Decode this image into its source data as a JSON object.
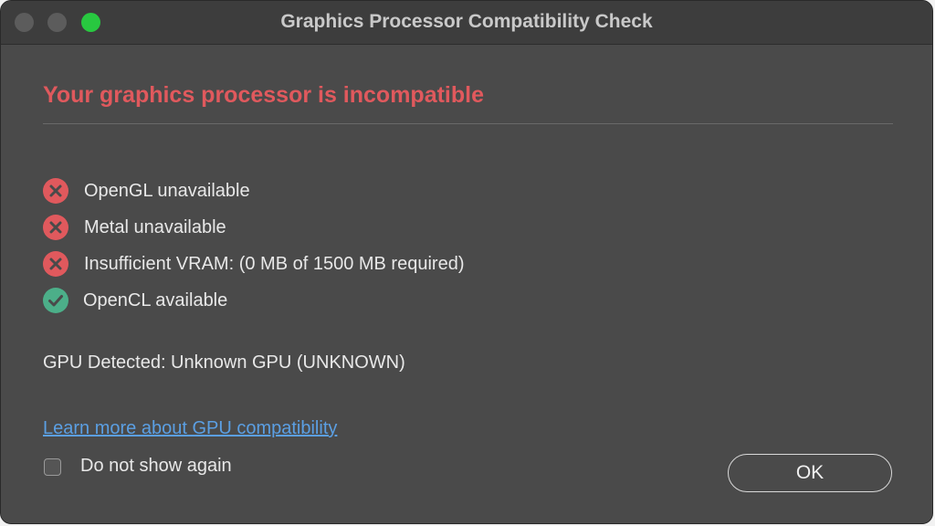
{
  "window": {
    "title": "Graphics Processor Compatibility Check"
  },
  "dialog": {
    "heading": "Your graphics processor is incompatible",
    "checks": [
      {
        "label": "OpenGL unavailable",
        "status": "fail",
        "icon": "x-circle-icon"
      },
      {
        "label": "Metal unavailable",
        "status": "fail",
        "icon": "x-circle-icon"
      },
      {
        "label": "Insufficient VRAM: (0 MB of 1500 MB required)",
        "status": "fail",
        "icon": "x-circle-icon"
      },
      {
        "label": "OpenCL available",
        "status": "pass",
        "icon": "check-circle-icon"
      }
    ],
    "gpu_detected": "GPU Detected: Unknown GPU (UNKNOWN)",
    "learn_more_link": "Learn more about GPU compatibility",
    "do_not_show_label": "Do not show again",
    "do_not_show_checked": false,
    "ok_label": "OK"
  },
  "colors": {
    "error": "#e0595d",
    "success": "#4caf89",
    "link": "#5b9fe3",
    "window_bg": "#4a4a4a",
    "titlebar_bg": "#3d3d3d",
    "zoom_button": "#28c840"
  }
}
